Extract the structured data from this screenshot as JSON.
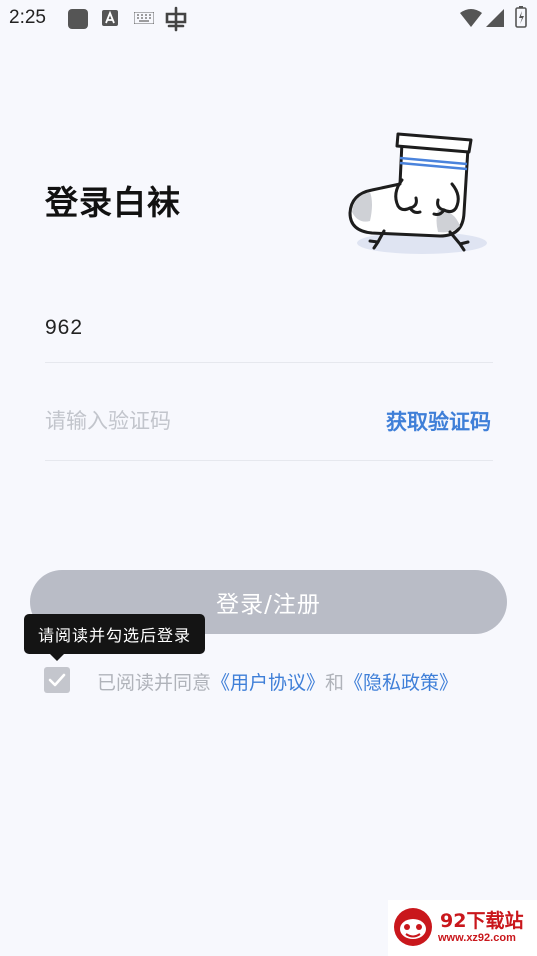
{
  "status_bar": {
    "time": "2:25"
  },
  "login": {
    "title": "登录白袜",
    "phone_value": "962",
    "code_placeholder": "请输入验证码",
    "get_code_label": "获取验证码",
    "submit_label": "登录/注册",
    "tooltip": "请阅读并勾选后登录"
  },
  "agreement": {
    "prefix": "已阅读并同意",
    "user_agreement": "《用户协议》",
    "and": "和",
    "privacy_policy": "《隐私政策》"
  },
  "watermark": {
    "name": "92下载站",
    "url": "www.xz92.com"
  },
  "colors": {
    "accent": "#3f7fd8",
    "background": "#f7f8fd",
    "button_disabled": "#b9bcc6",
    "watermark": "#c9171c"
  }
}
